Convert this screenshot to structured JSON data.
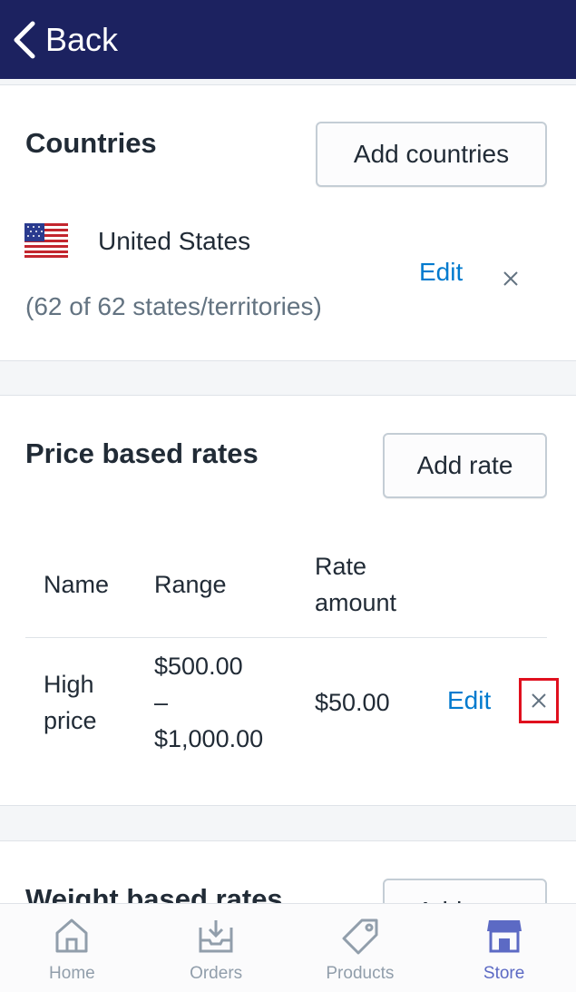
{
  "nav": {
    "back_label": "Back"
  },
  "countries": {
    "title": "Countries",
    "add_button": "Add countries",
    "country_name": "United States",
    "states_summary": "(62 of 62 states/territories)",
    "edit_label": "Edit"
  },
  "price_rates": {
    "title": "Price based rates",
    "add_button": "Add rate",
    "headers": {
      "name": "Name",
      "range": "Range",
      "rate_line1": "Rate",
      "rate_line2": "amount"
    },
    "row": {
      "name_line1": "High",
      "name_line2": "price",
      "range_line1": "$500.00",
      "range_line2": "–",
      "range_line3": "$1,000.00",
      "amount": "$50.00",
      "edit_label": "Edit"
    }
  },
  "weight_rates": {
    "title": "Weight based rates",
    "add_button": "Add rate"
  },
  "tabs": [
    {
      "label": "Home",
      "icon": "home-icon"
    },
    {
      "label": "Orders",
      "icon": "orders-icon"
    },
    {
      "label": "Products",
      "icon": "tag-icon"
    },
    {
      "label": "Store",
      "icon": "store-icon"
    }
  ],
  "colors": {
    "nav_bg": "#1c2260",
    "link": "#007ace",
    "active_tab": "#5c6ac4",
    "highlight": "#e0101e"
  }
}
